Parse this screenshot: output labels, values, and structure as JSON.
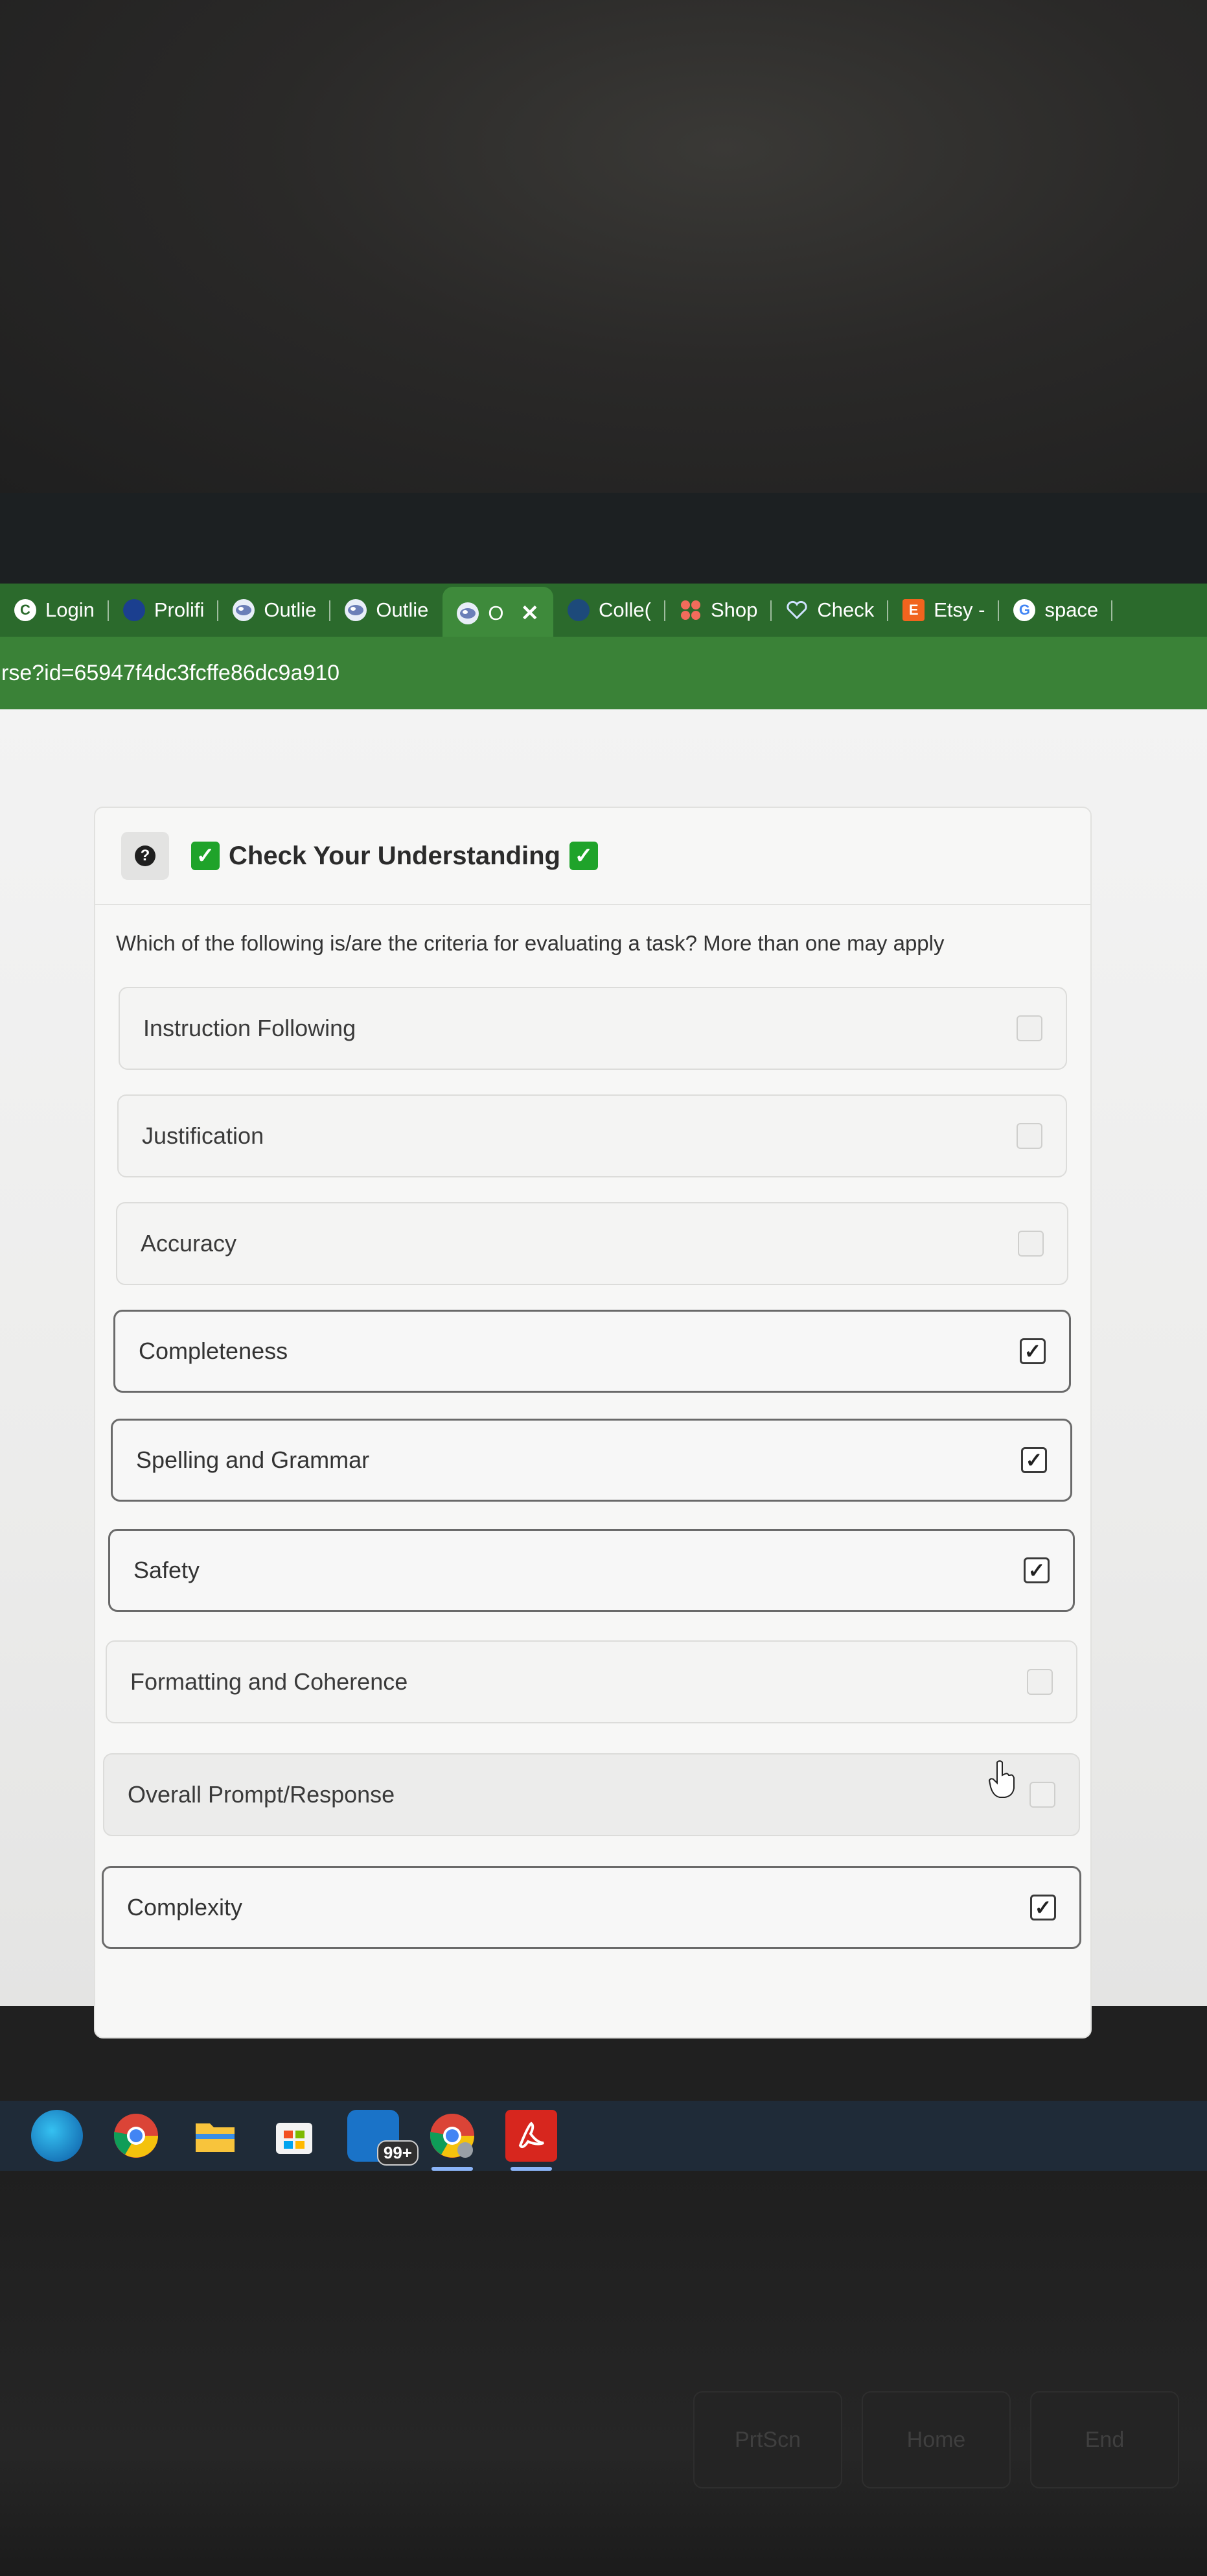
{
  "browser": {
    "tabs": [
      {
        "label": "Login",
        "icon": "circle-c-icon",
        "active": false
      },
      {
        "label": "Prolifi",
        "icon": "prolific-icon",
        "active": false
      },
      {
        "label": "Outlie",
        "icon": "outlier-icon",
        "active": false
      },
      {
        "label": "Outlie",
        "icon": "outlier-icon",
        "active": false
      },
      {
        "label": "O",
        "icon": "outlier-icon",
        "active": true
      },
      {
        "label": "Colle(",
        "icon": "college-icon",
        "active": false
      },
      {
        "label": "Shop",
        "icon": "shop-icon",
        "active": false
      },
      {
        "label": "Check",
        "icon": "heart-icon",
        "active": false
      },
      {
        "label": "Etsy -",
        "icon": "etsy-icon",
        "active": false
      },
      {
        "label": "space",
        "icon": "google-icon",
        "active": false
      }
    ],
    "close_glyph": "✕",
    "url": "rse?id=65947f4dc3fcffe86dc9a910"
  },
  "card": {
    "help_glyph": "?",
    "title": "Check Your Understanding",
    "check_glyph": "✓",
    "question": "Which of the following is/are the criteria for evaluating a task? More than one may apply",
    "options": [
      {
        "label": "Instruction Following",
        "checked": false
      },
      {
        "label": "Justification",
        "checked": false
      },
      {
        "label": "Accuracy",
        "checked": false
      },
      {
        "label": "Completeness",
        "checked": true
      },
      {
        "label": "Spelling and Grammar",
        "checked": true
      },
      {
        "label": "Safety",
        "checked": true
      },
      {
        "label": "Formatting and Coherence",
        "checked": false
      },
      {
        "label": "Overall Prompt/Response",
        "checked": false
      },
      {
        "label": "Complexity",
        "checked": true
      }
    ]
  },
  "taskbar": {
    "items": [
      {
        "name": "edge-icon"
      },
      {
        "name": "chrome-icon"
      },
      {
        "name": "file-explorer-icon"
      },
      {
        "name": "store-icon"
      },
      {
        "name": "mail-icon",
        "badge": "99+"
      },
      {
        "name": "chrome-profile-icon"
      },
      {
        "name": "acrobat-icon"
      }
    ]
  },
  "keyboard": {
    "keys": [
      "PrtScn",
      "Home",
      "End"
    ]
  },
  "colors": {
    "tabstrip": "#2b6a2c",
    "addressbar": "#3a8237",
    "check_emoji": "#1fa32a"
  }
}
